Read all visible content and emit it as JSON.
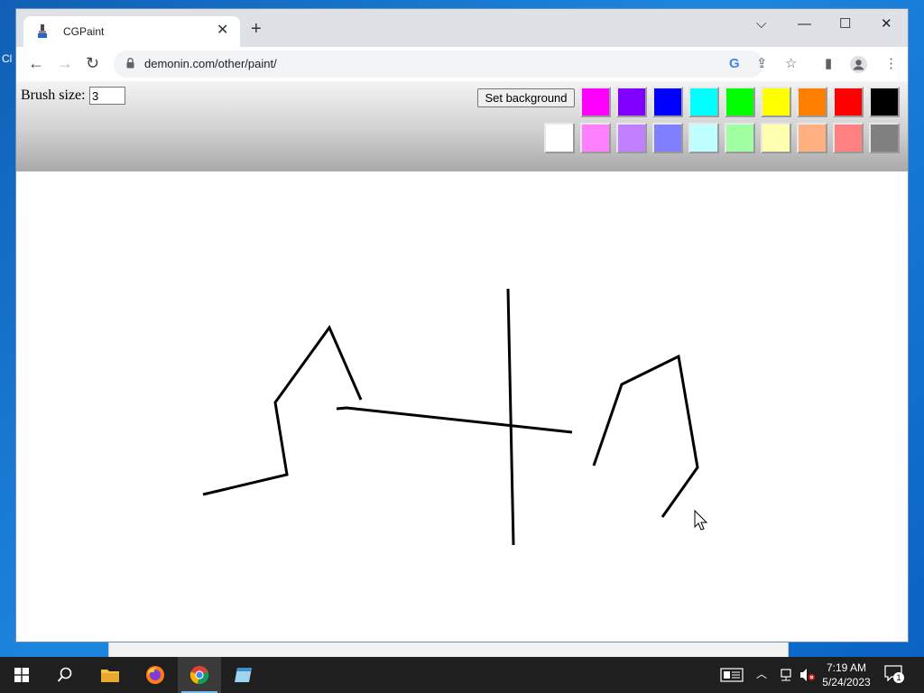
{
  "desktop": {
    "edge_label": "Cl"
  },
  "browser": {
    "tab": {
      "title": "CGPaint",
      "close_glyph": "✕"
    },
    "new_tab_glyph": "+",
    "window_controls": {
      "dropdown": "⌵",
      "minimize": "—",
      "maximize": "☐",
      "close": "✕"
    },
    "nav": {
      "back": "←",
      "forward": "→",
      "reload": "↻"
    },
    "url": "demonin.com/other/paint/",
    "omnibox_icons": {
      "google": "G",
      "share": "⇪",
      "star": "☆"
    },
    "toolbar_icons": {
      "sidepanel": "▮",
      "menu": "⋮"
    }
  },
  "paint": {
    "brush_label": "Brush size:",
    "brush_size": "3",
    "set_background_label": "Set background",
    "palette_row1": [
      "#ff00ff",
      "#8000ff",
      "#0000ff",
      "#00ffff",
      "#00ff00",
      "#ffff00",
      "#ff8000",
      "#ff0000",
      "#000000"
    ],
    "palette_row2": [
      "#ffffff",
      "#ff80ff",
      "#c080ff",
      "#8080ff",
      "#c0ffff",
      "#a0ffa0",
      "#ffffb0",
      "#ffb080",
      "#ff8080",
      "#808080"
    ],
    "stroke_color": "#000000"
  },
  "taskbar": {
    "apps": [
      "windows-start",
      "search",
      "file-explorer",
      "firefox",
      "chrome",
      "notepad"
    ],
    "active_app": "chrome",
    "notifications_count": "1",
    "time": "7:19 AM",
    "date": "5/24/2023"
  }
}
